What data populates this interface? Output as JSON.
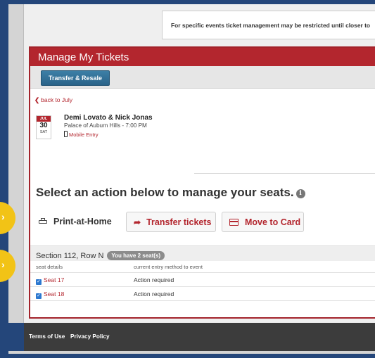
{
  "notice": {
    "text": "For specific events ticket management may be restricted until closer to"
  },
  "card": {
    "title": "Manage My Tickets",
    "toolbar_button": "Transfer & Resale"
  },
  "back_link": "back to July",
  "event": {
    "month": "JUL",
    "day": "30",
    "weekday": "SAT",
    "title": "Demi Lovato & Nick Jonas",
    "venue": "Palace of Auburn Hills - 7:00 PM",
    "entry": "Mobile Entry"
  },
  "manage": {
    "headline": "Select an action below to manage your seats.",
    "info_icon": "i",
    "print_label": "Print-at-Home",
    "transfer_label": "Transfer tickets",
    "move_label": "Move to Card"
  },
  "seating": {
    "section": "Section 112, Row N",
    "seat_count": "You have 2 seat(s)",
    "columns": [
      "seat details",
      "current entry method to event"
    ],
    "rows": [
      {
        "seat": "Seat 17",
        "status": "Action required",
        "checked": true
      },
      {
        "seat": "Seat 18",
        "status": "Action required",
        "checked": true
      }
    ]
  },
  "footer": {
    "terms": "Terms of Use",
    "privacy": "Privacy Policy"
  },
  "icons": {
    "back": "chevron-left-icon",
    "phone": "mobile-phone-icon",
    "info": "info-icon",
    "print": "printer-icon",
    "transfer": "share-arrow-icon",
    "move": "credit-card-icon",
    "checkbox": "checkbox-checked-icon"
  },
  "colors": {
    "brand_red": "#b3262e",
    "button_blue": "#2a6389",
    "frame_blue": "#24467a",
    "highlight_yellow": "#f2c316"
  }
}
